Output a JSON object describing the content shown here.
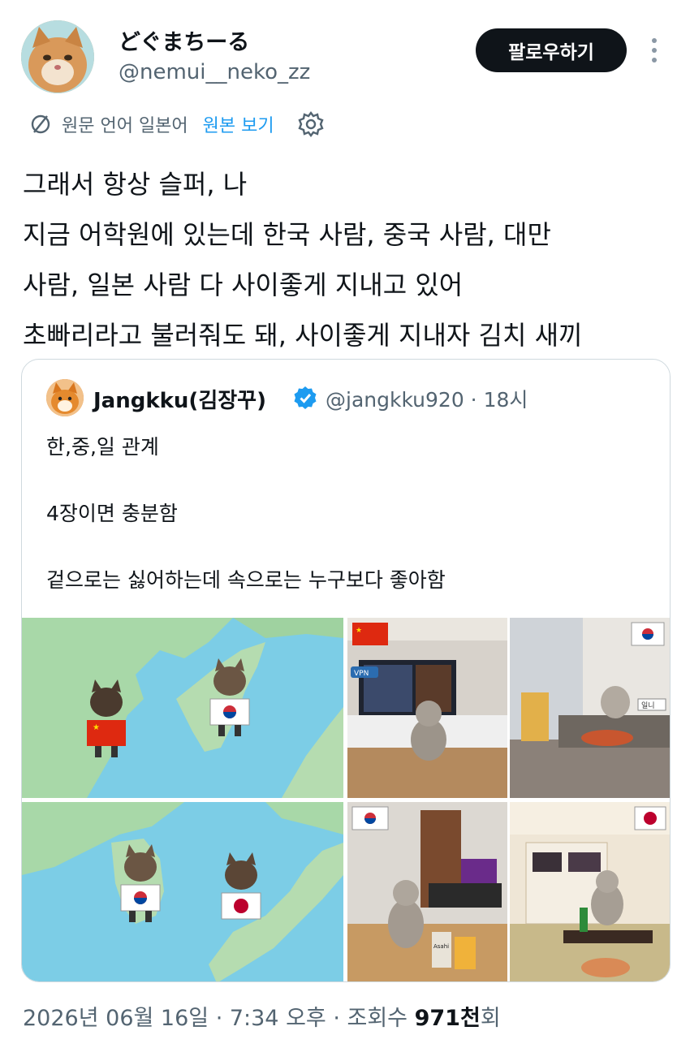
{
  "author": {
    "display_name": "どぐまちーる",
    "handle": "@nemui__neko_zz"
  },
  "follow_label": "팔로우하기",
  "translation": {
    "label": "원문 언어 일본어",
    "show_original": "원본 보기"
  },
  "tweet_lines": [
    "그래서 항상 슬퍼, 나",
    "지금 어학원에 있는데 한국 사람, 중국 사람, 대만",
    "사람, 일본 사람 다 사이좋게 지내고 있어",
    "초빠리라고 불러줘도 돼, 사이좋게 지내자 김치 새끼"
  ],
  "quote": {
    "name": "Jangkku(김장꾸)",
    "handle_time": "@jangkku920 · 18시",
    "lines": [
      "한,중,일 관계",
      "",
      "4장이면 충분함",
      "",
      "겉으로는 싫어하는데 속으로는 누구보다 좋아함"
    ],
    "images": [
      {
        "kind": "map",
        "flags": [
          "cn",
          "kr"
        ]
      },
      {
        "kind": "room",
        "flags": [
          "cn"
        ],
        "sign": "VPN"
      },
      {
        "kind": "map",
        "flags": [
          "kr",
          "jp"
        ]
      },
      {
        "kind": "room",
        "flags": [
          "kr"
        ],
        "sign": "Asahi"
      }
    ],
    "image_extra": {
      "room2_flag": "kr",
      "room2_sign": "일니",
      "room4_flag": "jp"
    }
  },
  "footer": {
    "datetime": "2026년 06월 16일 · 7:34 오후 · 조회수 ",
    "views": "971",
    "views_unit": "천",
    "views_suffix": "회"
  },
  "colors": {
    "text": "#0f1419",
    "secondary": "#536471",
    "link": "#1d9bf0",
    "border": "#cfd9de",
    "map_sea": "#7ccde6",
    "map_land": "#a8d8a8"
  }
}
